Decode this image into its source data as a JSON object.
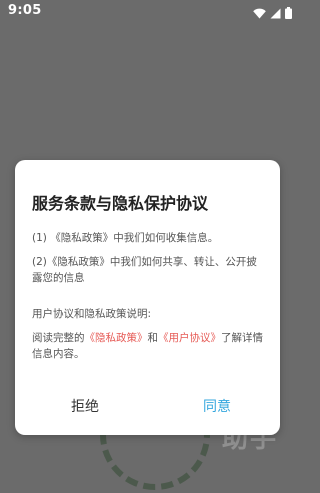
{
  "status_bar": {
    "time": "9:05",
    "icons": [
      "wifi-icon",
      "signal-icon",
      "battery-icon"
    ]
  },
  "dialog": {
    "title": "服务条款与隐私保护协议",
    "item1_prefix": "(1) ",
    "item1_link": "《隐私政策》",
    "item1_suffix": "中我们如何收集信息。",
    "item2": "(2)《隐私政策》中我们如何共享、转让、公开披露您的信息",
    "explain_title": "用户协议和隐私政策说明:",
    "explain_prefix": "阅读完整的",
    "privacy_link": "《隐私政策》",
    "explain_and": "和",
    "user_agreement_link": "《用户协议》",
    "explain_suffix": "了解详情信息内容。",
    "reject_label": "拒绝",
    "agree_label": "同意"
  },
  "background": {
    "watermark_text": "助手"
  },
  "colors": {
    "overlay": "#6b6b6b",
    "link": "#e65a55",
    "agree": "#35a7de"
  }
}
